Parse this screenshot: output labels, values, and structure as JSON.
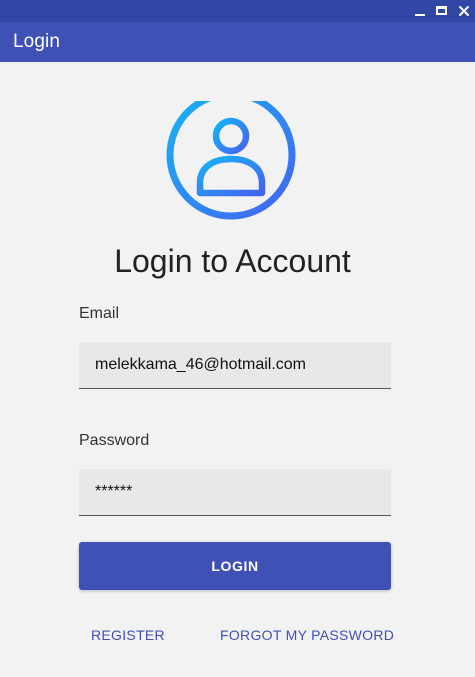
{
  "window": {
    "minimize_icon": "minimize-icon",
    "maximize_icon": "maximize-icon",
    "close_icon": "close-icon"
  },
  "app_bar": {
    "title": "Login"
  },
  "avatar": {
    "icon": "user-circle-icon",
    "gradient_start": "#16b4f5",
    "gradient_end": "#4463f2"
  },
  "heading": "Login to Account",
  "email": {
    "label": "Email",
    "value": "melekkama_46@hotmail.com"
  },
  "password": {
    "label": "Password",
    "value": "******"
  },
  "login_button": "LOGIN",
  "links": {
    "register": "REGISTER",
    "forgot_password": "FORGOT MY PASSWORD"
  },
  "colors": {
    "primary": "#3f51b5",
    "window_bar": "#3047a6",
    "background": "#f2f2f2",
    "field_background": "#e8e8e8"
  }
}
